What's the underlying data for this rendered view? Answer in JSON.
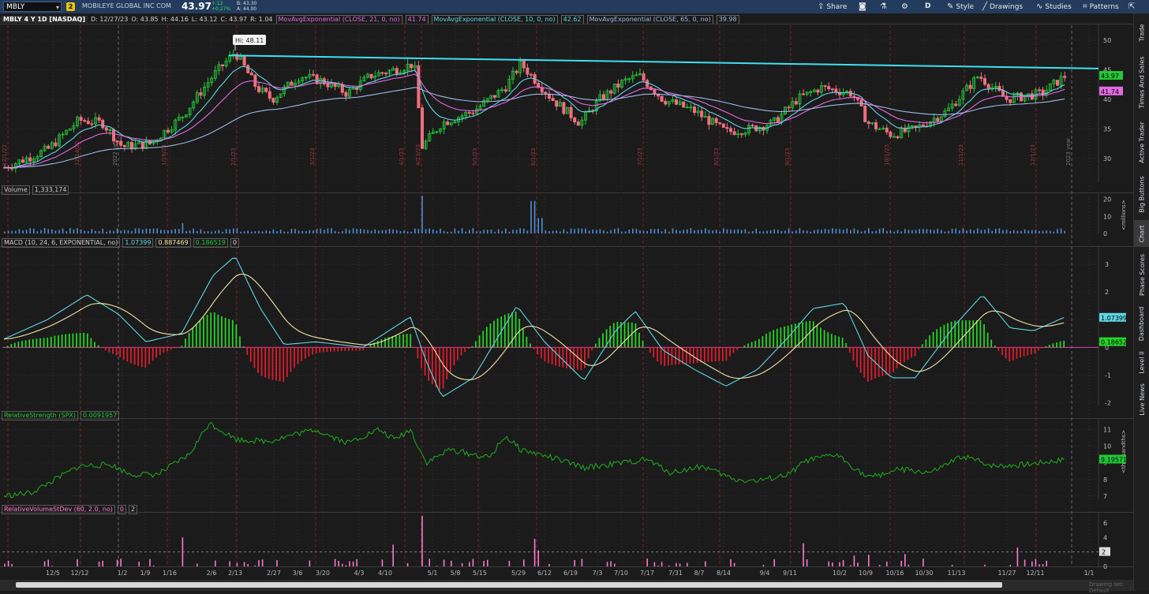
{
  "toolbar": {
    "symbol": "MBLY",
    "link_badge": "2",
    "company": "MOBILEYE GLOBAL INC COM",
    "last": "43.97",
    "change_abs": "+.12",
    "change_pct": "+0.27%",
    "bid": "B: 43.30",
    "ask": "A: 44.00",
    "share": "Share",
    "period_d": "D",
    "style": "Style",
    "drawings": "Drawings",
    "studies": "Studies",
    "patterns": "Patterns"
  },
  "header": {
    "title": "MBLY 4 Y 1D [NASDAQ]",
    "date": "D: 12/27/23",
    "open": "O: 43.85",
    "high": "H: 44.16",
    "low": "L: 43.12",
    "close": "C: 43.97",
    "range": "R: 1.04",
    "ema21_label": "MovAvgExponential (CLOSE, 21, 0, no)",
    "ema21_value": "41.74",
    "ema10_label": "MovAvgExponential (CLOSE, 10, 0, no)",
    "ema10_value": "42.62",
    "ema65_label": "MovAvgExponential (CLOSE, 65, 0, no)",
    "ema65_value": "39.98"
  },
  "hi_bubble": "Hi: 48.11",
  "price_axis": {
    "ticks": [
      "50",
      "45",
      "40",
      "35",
      "30"
    ],
    "last_badge": "43.97",
    "ema_badge": "41.74"
  },
  "vertical_markers": [
    "12/1/22",
    "12/14/22",
    "2022 year",
    "1/16/23",
    "2/1/23",
    "3/1/23",
    "4/1/23",
    "4/23/23",
    "5/1/23",
    "6/1/23",
    "7/1/23",
    "8/1/23",
    "9/1/23",
    "10/1/23",
    "11/1/23",
    "12/1/23",
    "2023 year"
  ],
  "volume": {
    "label": "Volume",
    "value": "1,333,174",
    "ticks": [
      "20",
      "10",
      "0"
    ],
    "unit": "<millions>"
  },
  "macd": {
    "label": "MACD (10, 24, 6, EXPONENTIAL, no)",
    "v1": "1.07399",
    "v2": "0.887469",
    "v3": "0.186519",
    "v4": "0",
    "ticks": [
      "3",
      "2",
      "1",
      "0",
      "-1",
      "-2"
    ],
    "badge1": "1.07399",
    "badge2": "0.18652"
  },
  "rs": {
    "label": "RelativeStrength (SPX)",
    "value": "0.0091957",
    "ticks": [
      "11",
      "10",
      "9",
      "8",
      "7"
    ],
    "badge": "9.19571",
    "unit": "<thousandths>"
  },
  "rvsd": {
    "label": "RelativeVolumeStDev (60, 2.0, no)",
    "v1": "0",
    "v2": "2",
    "ticks": [
      "6",
      "4",
      "2",
      "0"
    ],
    "badge": "2"
  },
  "x_axis": [
    "12/5",
    "12/12",
    "1/2",
    "1/9",
    "1/16",
    "2/6",
    "2/13",
    "2/27",
    "3/6",
    "3/20",
    "4/3",
    "4/10",
    "5/1",
    "5/8",
    "5/15",
    "5/29",
    "6/12",
    "6/19",
    "7/3",
    "7/10",
    "7/17",
    "7/31",
    "8/7",
    "8/14",
    "9/4",
    "9/11",
    "10/2",
    "10/9",
    "10/16",
    "10/30",
    "11/13",
    "11/27",
    "12/11",
    "1/1"
  ],
  "right_tabs": [
    "Trade",
    "Times And Sales",
    "Active Trader",
    "Big Buttons",
    "Chart",
    "Phase Scores",
    "Dashboard",
    "Level II",
    "Live News"
  ],
  "scroll_note": "Drawing set: Default",
  "colors": {
    "up": "#22c838",
    "down": "#f06f7e",
    "ema10": "#5fd6e6",
    "ema21": "#e36ae3",
    "ema65": "#9db9e8",
    "trend": "#3fe0f0",
    "rs": "#1fae1f",
    "rvsd": "#ff78d2"
  }
}
